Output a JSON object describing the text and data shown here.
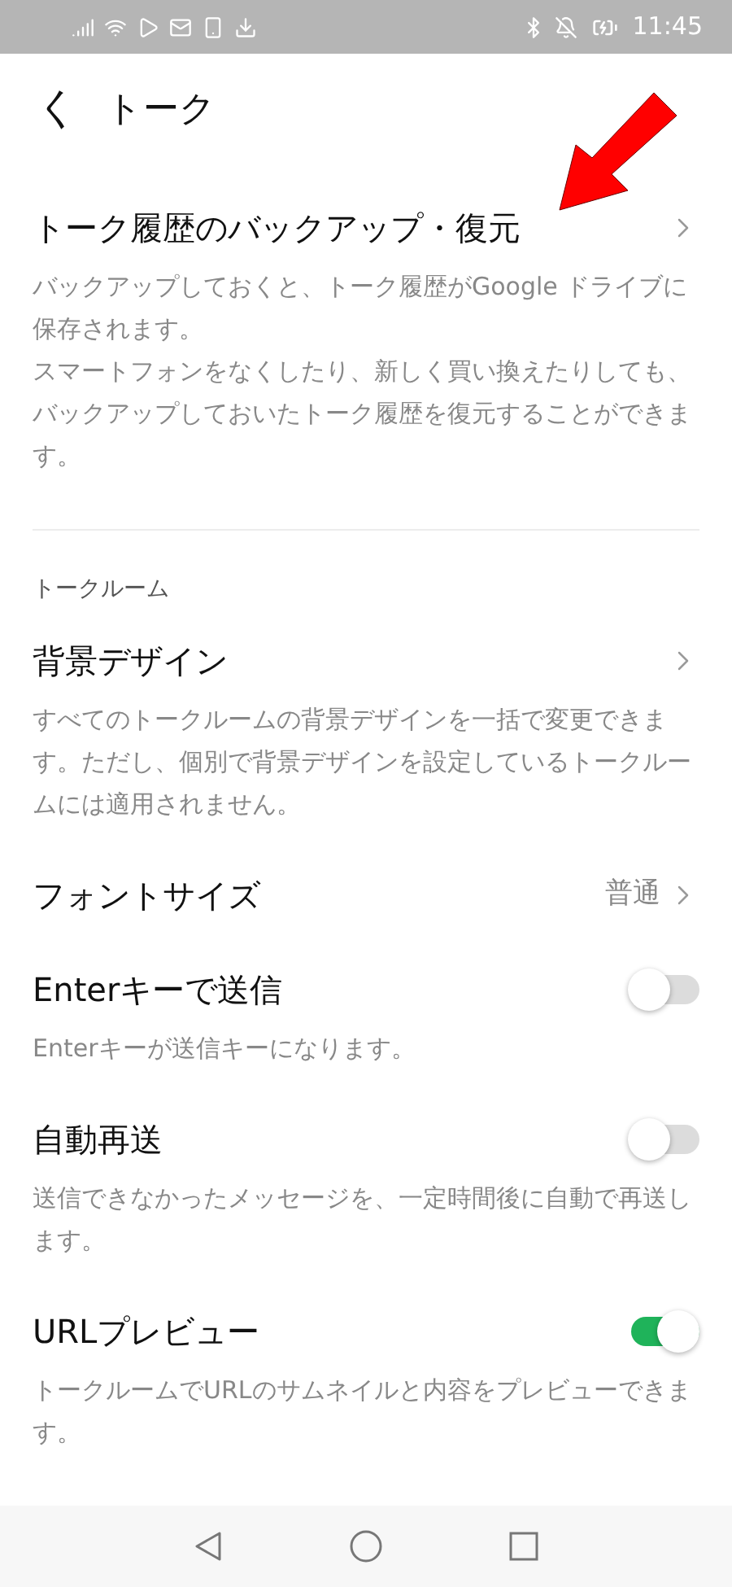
{
  "status_bar": {
    "time": "11:45"
  },
  "header": {
    "back": "く",
    "title": "トーク"
  },
  "sections": [
    {
      "items": [
        {
          "kind": "link",
          "title": "トーク履歴のバックアップ・復元",
          "description": [
            "バックアップしておくと、トーク履歴がGoogle ドライブに保存されます。",
            "スマートフォンをなくしたり、新しく買い換えたりしても、バックアップしておいたトーク履歴を復元することができます。"
          ]
        }
      ]
    },
    {
      "heading": "トークルーム",
      "items": [
        {
          "kind": "link",
          "title": "背景デザイン",
          "description": [
            "すべてのトークルームの背景デザインを一括で変更できます。ただし、個別で背景デザインを設定しているトークルームには適用されません。"
          ]
        },
        {
          "kind": "value",
          "title": "フォントサイズ",
          "value": "普通"
        },
        {
          "kind": "toggle",
          "title": "Enterキーで送信",
          "on": false,
          "description": [
            "Enterキーが送信キーになります。"
          ]
        },
        {
          "kind": "toggle",
          "title": "自動再送",
          "on": false,
          "description": [
            "送信できなかったメッセージを、一定時間後に自動で再送します。"
          ]
        },
        {
          "kind": "toggle",
          "title": "URLプレビュー",
          "on": true,
          "description": [
            "トークルームでURLのサムネイルと内容をプレビューできます。"
          ]
        }
      ]
    }
  ]
}
